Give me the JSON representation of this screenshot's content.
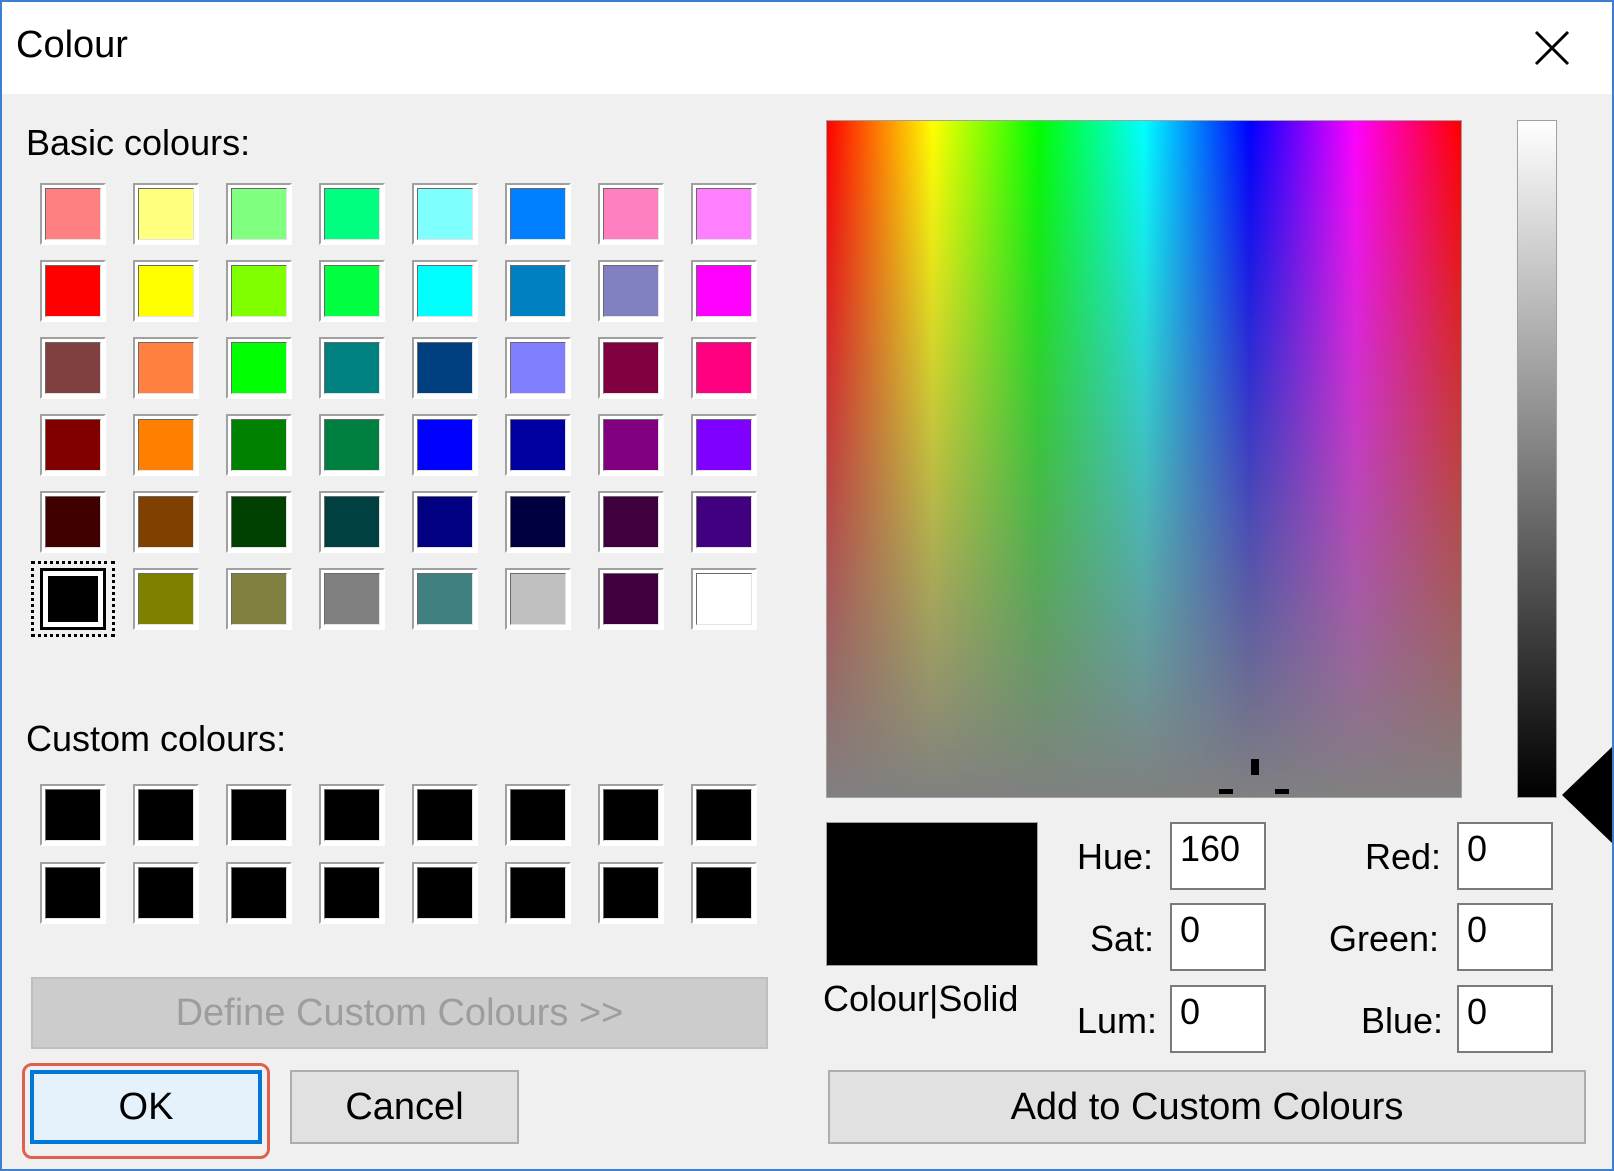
{
  "window": {
    "title": "Colour"
  },
  "labels": {
    "basic_colours": "Basic colours:",
    "custom_colours": "Custom colours:",
    "colour_solid": "Colour|Solid",
    "hue": "Hue:",
    "sat": "Sat:",
    "lum": "Lum:",
    "red": "Red:",
    "green": "Green:",
    "blue": "Blue:"
  },
  "basic_colours": [
    "#ff8080",
    "#ffff80",
    "#80ff80",
    "#00ff80",
    "#80ffff",
    "#0080ff",
    "#ff80c0",
    "#ff80ff",
    "#ff0000",
    "#ffff00",
    "#80ff00",
    "#00ff40",
    "#00ffff",
    "#0080c0",
    "#8080c0",
    "#ff00ff",
    "#804040",
    "#ff8040",
    "#00ff00",
    "#008080",
    "#004080",
    "#8080ff",
    "#800040",
    "#ff0080",
    "#800000",
    "#ff8000",
    "#008000",
    "#008040",
    "#0000ff",
    "#0000a0",
    "#800080",
    "#8000ff",
    "#400000",
    "#804000",
    "#004000",
    "#004040",
    "#000080",
    "#000040",
    "#400040",
    "#400080",
    "#000000",
    "#808000",
    "#808040",
    "#808080",
    "#408080",
    "#c0c0c0",
    "#400040",
    "#ffffff"
  ],
  "selected_basic_index": 40,
  "custom_colours": [
    "#000000",
    "#000000",
    "#000000",
    "#000000",
    "#000000",
    "#000000",
    "#000000",
    "#000000",
    "#000000",
    "#000000",
    "#000000",
    "#000000",
    "#000000",
    "#000000",
    "#000000",
    "#000000"
  ],
  "values": {
    "hue": "160",
    "sat": "0",
    "lum": "0",
    "red": "0",
    "green": "0",
    "blue": "0"
  },
  "preview_colour": "#000000",
  "buttons": {
    "define_custom": "Define Custom Colours >>",
    "ok": "OK",
    "cancel": "Cancel",
    "add_custom": "Add to Custom Colours"
  }
}
